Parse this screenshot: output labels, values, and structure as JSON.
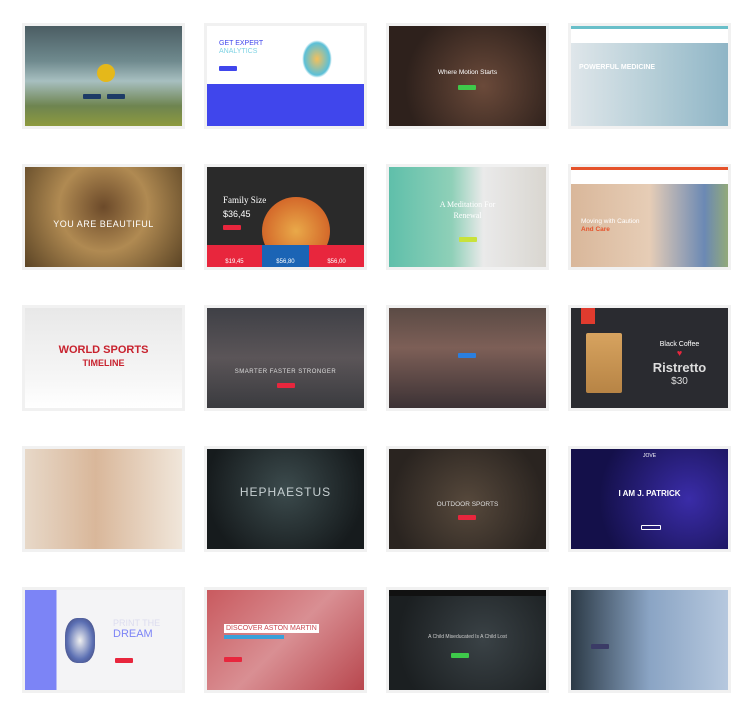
{
  "cards": [
    {
      "id": "mountain"
    },
    {
      "line1": "GET EXPERT",
      "line2": "ANALYTICS"
    },
    {
      "title": "Where Motion Starts"
    },
    {
      "title": "POWERFUL MEDICINE"
    },
    {
      "title": "YOU ARE BEAUTIFUL"
    },
    {
      "title": "Family Size",
      "price": "$36,45",
      "prices": [
        "$19,45",
        "$56,80",
        "$56,00"
      ]
    },
    {
      "line1": "A Meditation For",
      "line2": "Renewal"
    },
    {
      "line1": "Moving with Caution",
      "line2": "And Care"
    },
    {
      "line1": "WORLD SPORTS",
      "line2": "TIMELINE"
    },
    {
      "title": "SMARTER FASTER STRONGER"
    },
    {
      "id": "team"
    },
    {
      "line1": "Black Coffee",
      "line2": "Ristretto",
      "price": "$30"
    },
    {
      "id": "woman"
    },
    {
      "title": "HEPHAESTUS"
    },
    {
      "title": "OUTDOOR SPORTS"
    },
    {
      "logo": "JOVE",
      "title": "I AM J. PATRICK"
    },
    {
      "line1": "PRINT THE",
      "line2": "DREAM"
    },
    {
      "title": "DISCOVER ASTON MARTIN"
    },
    {
      "title": "A Child Miseducated Is A Child Lost"
    },
    {
      "id": "teacher"
    }
  ],
  "colors": {
    "accent_red": "#e8263d",
    "accent_blue": "#4046ec",
    "accent_green": "#3ec94a"
  }
}
